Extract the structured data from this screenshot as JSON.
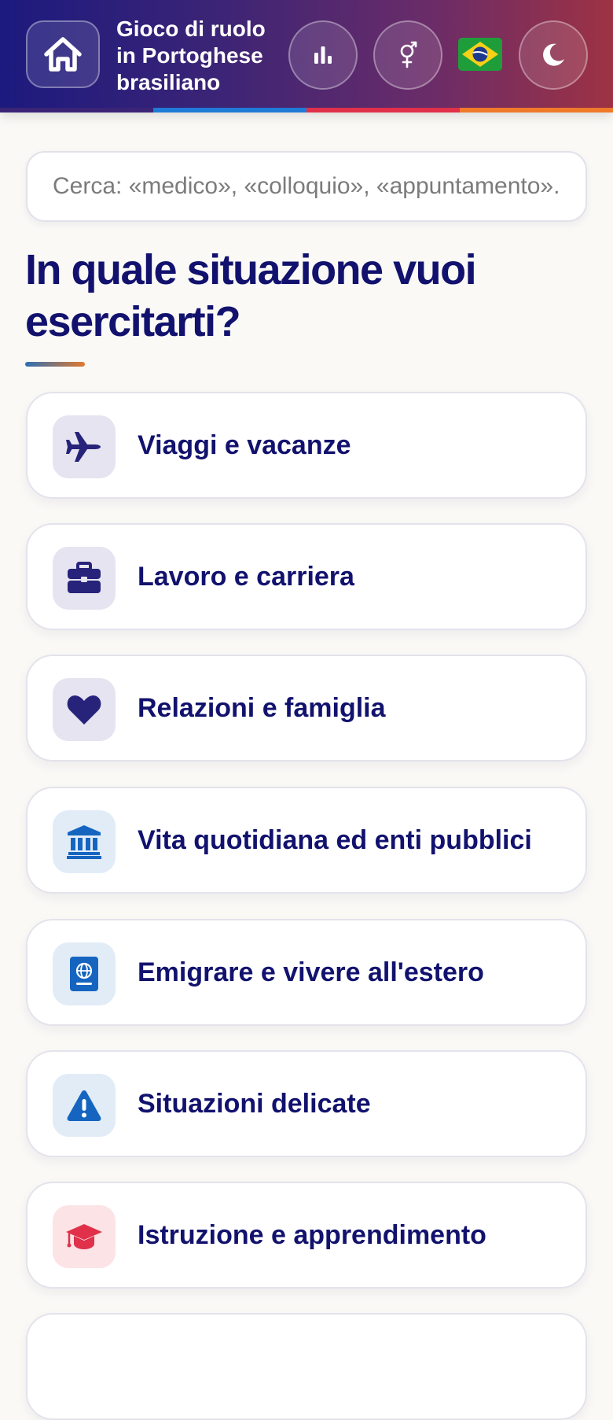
{
  "header": {
    "title_line1": "Gioco di ruolo",
    "title_line2": "in Portoghese",
    "title_line3": "brasiliano",
    "home_icon": "home-icon",
    "stats_icon": "bar-chart-icon",
    "gender_icon": "gender-icon",
    "language_flag_icon": "brazil-flag-icon",
    "theme_icon": "moon-icon",
    "gradient_colors": [
      "#1c1a7e",
      "#3b2476",
      "#6a2c68",
      "#9e3244"
    ],
    "stripe_colors": [
      "#3b2476",
      "#1f7bd6",
      "#e0304a",
      "#ef7a2a"
    ]
  },
  "search": {
    "placeholder": "Cerca: «medico», «colloquio», «appuntamento»..."
  },
  "main": {
    "heading": "In quale situazione vuoi esercitarti?",
    "categories": [
      {
        "label": "Viaggi e vacanze",
        "icon": "airplane-icon",
        "icon_color": "#27237a",
        "icon_bg": "#e5e4f0"
      },
      {
        "label": "Lavoro e carriera",
        "icon": "briefcase-icon",
        "icon_color": "#27237a",
        "icon_bg": "#e5e4f0"
      },
      {
        "label": "Relazioni e famiglia",
        "icon": "heart-icon",
        "icon_color": "#27237a",
        "icon_bg": "#e5e4f0"
      },
      {
        "label": "Vita quotidiana ed enti pubblici",
        "icon": "bank-building-icon",
        "icon_color": "#1565c0",
        "icon_bg": "#e1ecf7"
      },
      {
        "label": "Emigrare e vivere all'estero",
        "icon": "passport-icon",
        "icon_color": "#1565c0",
        "icon_bg": "#e1ecf7"
      },
      {
        "label": "Situazioni delicate",
        "icon": "warning-icon",
        "icon_color": "#1565c0",
        "icon_bg": "#e1ecf7"
      },
      {
        "label": "Istruzione e apprendimento",
        "icon": "graduation-cap-icon",
        "icon_color": "#e0304a",
        "icon_bg": "#fbe3e6"
      }
    ]
  }
}
